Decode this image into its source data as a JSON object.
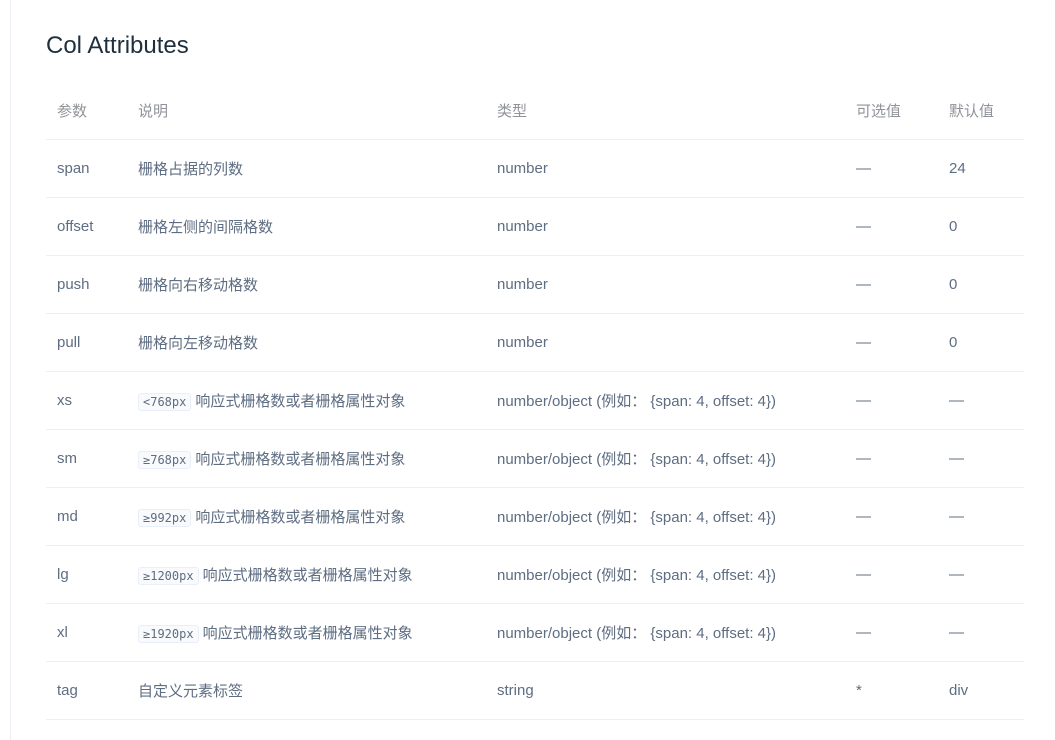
{
  "section": {
    "title": "Col Attributes"
  },
  "table": {
    "headers": {
      "param": "参数",
      "desc": "说明",
      "type": "类型",
      "options": "可选值",
      "default": "默认值"
    },
    "rows": [
      {
        "param": "span",
        "code": "",
        "desc": "栅格占据的列数",
        "type": "number",
        "options": "—",
        "default": "24"
      },
      {
        "param": "offset",
        "code": "",
        "desc": "栅格左侧的间隔格数",
        "type": "number",
        "options": "—",
        "default": "0"
      },
      {
        "param": "push",
        "code": "",
        "desc": "栅格向右移动格数",
        "type": "number",
        "options": "—",
        "default": "0"
      },
      {
        "param": "pull",
        "code": "",
        "desc": "栅格向左移动格数",
        "type": "number",
        "options": "—",
        "default": "0"
      },
      {
        "param": "xs",
        "code": "<768px",
        "desc": "响应式栅格数或者栅格属性对象",
        "type": "number/object (例如： {span: 4, offset: 4})",
        "options": "—",
        "default": "—"
      },
      {
        "param": "sm",
        "code": "≥768px",
        "desc": "响应式栅格数或者栅格属性对象",
        "type": "number/object (例如： {span: 4, offset: 4})",
        "options": "—",
        "default": "—"
      },
      {
        "param": "md",
        "code": "≥992px",
        "desc": "响应式栅格数或者栅格属性对象",
        "type": "number/object (例如： {span: 4, offset: 4})",
        "options": "—",
        "default": "—"
      },
      {
        "param": "lg",
        "code": "≥1200px",
        "desc": "响应式栅格数或者栅格属性对象",
        "type": "number/object (例如： {span: 4, offset: 4})",
        "options": "—",
        "default": "—"
      },
      {
        "param": "xl",
        "code": "≥1920px",
        "desc": "响应式栅格数或者栅格属性对象",
        "type": "number/object (例如： {span: 4, offset: 4})",
        "options": "—",
        "default": "—"
      },
      {
        "param": "tag",
        "code": "",
        "desc": "自定义元素标签",
        "type": "string",
        "options": "*",
        "default": "div"
      }
    ]
  }
}
